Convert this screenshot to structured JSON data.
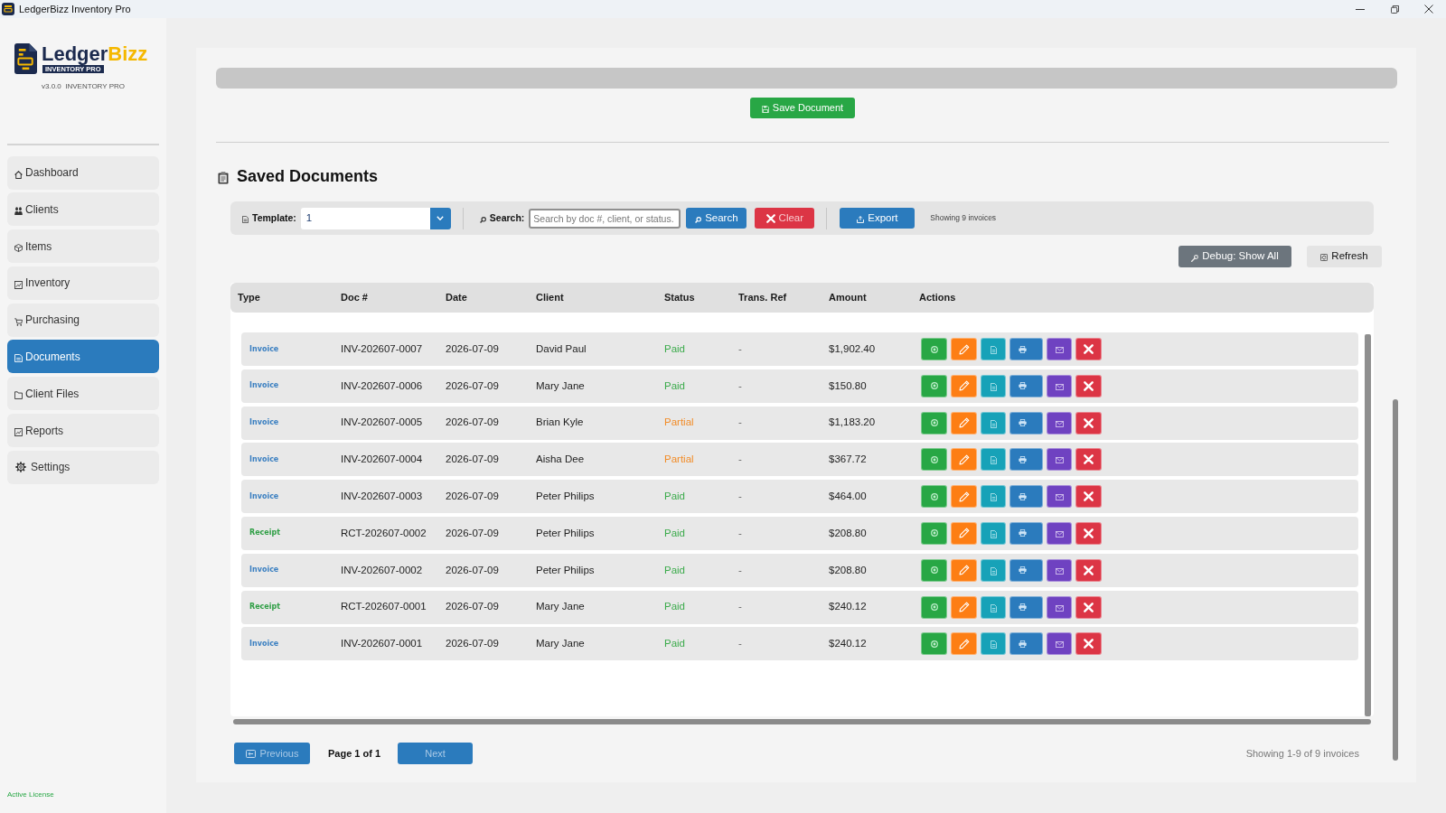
{
  "window": {
    "title": "LedgerBizz Inventory Pro"
  },
  "sidebar": {
    "logo": {
      "name_part_1": "Ledger",
      "name_part_2": "Bizz",
      "tagline": "INVENTORY PRO"
    },
    "version": "v3.0.0  INVENTORY PRO",
    "items": [
      {
        "label": "Dashboard",
        "kind": "home",
        "selected": false
      },
      {
        "label": "Clients",
        "kind": "people",
        "selected": false
      },
      {
        "label": "Items",
        "kind": "box",
        "selected": false
      },
      {
        "label": "Inventory",
        "kind": "chart",
        "selected": false
      },
      {
        "label": "Purchasing",
        "kind": "cart",
        "selected": false
      },
      {
        "label": "Documents",
        "kind": "document",
        "selected": true
      },
      {
        "label": "Client Files",
        "kind": "folder",
        "selected": false
      },
      {
        "label": "Reports",
        "kind": "chart",
        "selected": false
      },
      {
        "label": "Settings",
        "kind": "gear",
        "selected": false
      }
    ],
    "license": "Active License"
  },
  "document_editor": {
    "save_button": "Save Document"
  },
  "saved_documents": {
    "title": "Saved Documents",
    "toolbar": {
      "template": {
        "label": "Template:",
        "value": "1"
      },
      "search": {
        "label": "Search:",
        "placeholder": "Search by doc #, client, or status."
      },
      "buttons": [
        {
          "kind": "search",
          "label": "Search"
        },
        {
          "kind": "clear",
          "label": "Clear"
        },
        {
          "kind": "export",
          "label": "Export"
        }
      ],
      "count": "Showing 9 invoices"
    },
    "actions": [
      {
        "kind": "debug",
        "label": "Debug: Show All"
      },
      {
        "kind": "refresh",
        "label": "Refresh"
      }
    ],
    "table": {
      "columns": [
        "Type",
        "Doc #",
        "Date",
        "Client",
        "Status",
        "Trans. Ref",
        "Amount",
        "Actions"
      ],
      "rows": [
        {
          "type": {
            "text": "Invoice",
            "color": "#3a7fc1"
          },
          "doc_number": "INV-202607-0007",
          "date": "2026-07-09",
          "client": "David Paul",
          "status": {
            "text": "Paid",
            "color": "#3cab4c"
          },
          "trans_ref": "-",
          "amount": "$1,902.40"
        },
        {
          "type": {
            "text": "Invoice",
            "color": "#3a7fc1"
          },
          "doc_number": "INV-202607-0006",
          "date": "2026-07-09",
          "client": "Mary Jane",
          "status": {
            "text": "Paid",
            "color": "#3cab4c"
          },
          "trans_ref": "-",
          "amount": "$150.80"
        },
        {
          "type": {
            "text": "Invoice",
            "color": "#3a7fc1"
          },
          "doc_number": "INV-202607-0005",
          "date": "2026-07-09",
          "client": "Brian Kyle",
          "status": {
            "text": "Partial",
            "color": "#f28c28"
          },
          "trans_ref": "-",
          "amount": "$1,183.20"
        },
        {
          "type": {
            "text": "Invoice",
            "color": "#3a7fc1"
          },
          "doc_number": "INV-202607-0004",
          "date": "2026-07-09",
          "client": "Aisha Dee",
          "status": {
            "text": "Partial",
            "color": "#f28c28"
          },
          "trans_ref": "-",
          "amount": "$367.72"
        },
        {
          "type": {
            "text": "Invoice",
            "color": "#3a7fc1"
          },
          "doc_number": "INV-202607-0003",
          "date": "2026-07-09",
          "client": "Peter Philips",
          "status": {
            "text": "Paid",
            "color": "#3cab4c"
          },
          "trans_ref": "-",
          "amount": "$464.00"
        },
        {
          "type": {
            "text": "Receipt",
            "color": "#2e9e44"
          },
          "doc_number": "RCT-202607-0002",
          "date": "2026-07-09",
          "client": "Peter Philips",
          "status": {
            "text": "Paid",
            "color": "#3cab4c"
          },
          "trans_ref": "-",
          "amount": "$208.80"
        },
        {
          "type": {
            "text": "Invoice",
            "color": "#3a7fc1"
          },
          "doc_number": "INV-202607-0002",
          "date": "2026-07-09",
          "client": "Peter Philips",
          "status": {
            "text": "Paid",
            "color": "#3cab4c"
          },
          "trans_ref": "-",
          "amount": "$208.80"
        },
        {
          "type": {
            "text": "Receipt",
            "color": "#2e9e44"
          },
          "doc_number": "RCT-202607-0001",
          "date": "2026-07-09",
          "client": "Mary Jane",
          "status": {
            "text": "Paid",
            "color": "#3cab4c"
          },
          "trans_ref": "-",
          "amount": "$240.12"
        },
        {
          "type": {
            "text": "Invoice",
            "color": "#3a7fc1"
          },
          "doc_number": "INV-202607-0001",
          "date": "2026-07-09",
          "client": "Mary Jane",
          "status": {
            "text": "Paid",
            "color": "#3cab4c"
          },
          "trans_ref": "-",
          "amount": "$240.12"
        }
      ]
    },
    "pagination": {
      "previous": {
        "label": "Previous",
        "disabled": true
      },
      "page": "Page 1 of 1",
      "next": {
        "label": "Next",
        "disabled": true
      },
      "summary": "Showing 1-9 of 9 invoices"
    }
  }
}
